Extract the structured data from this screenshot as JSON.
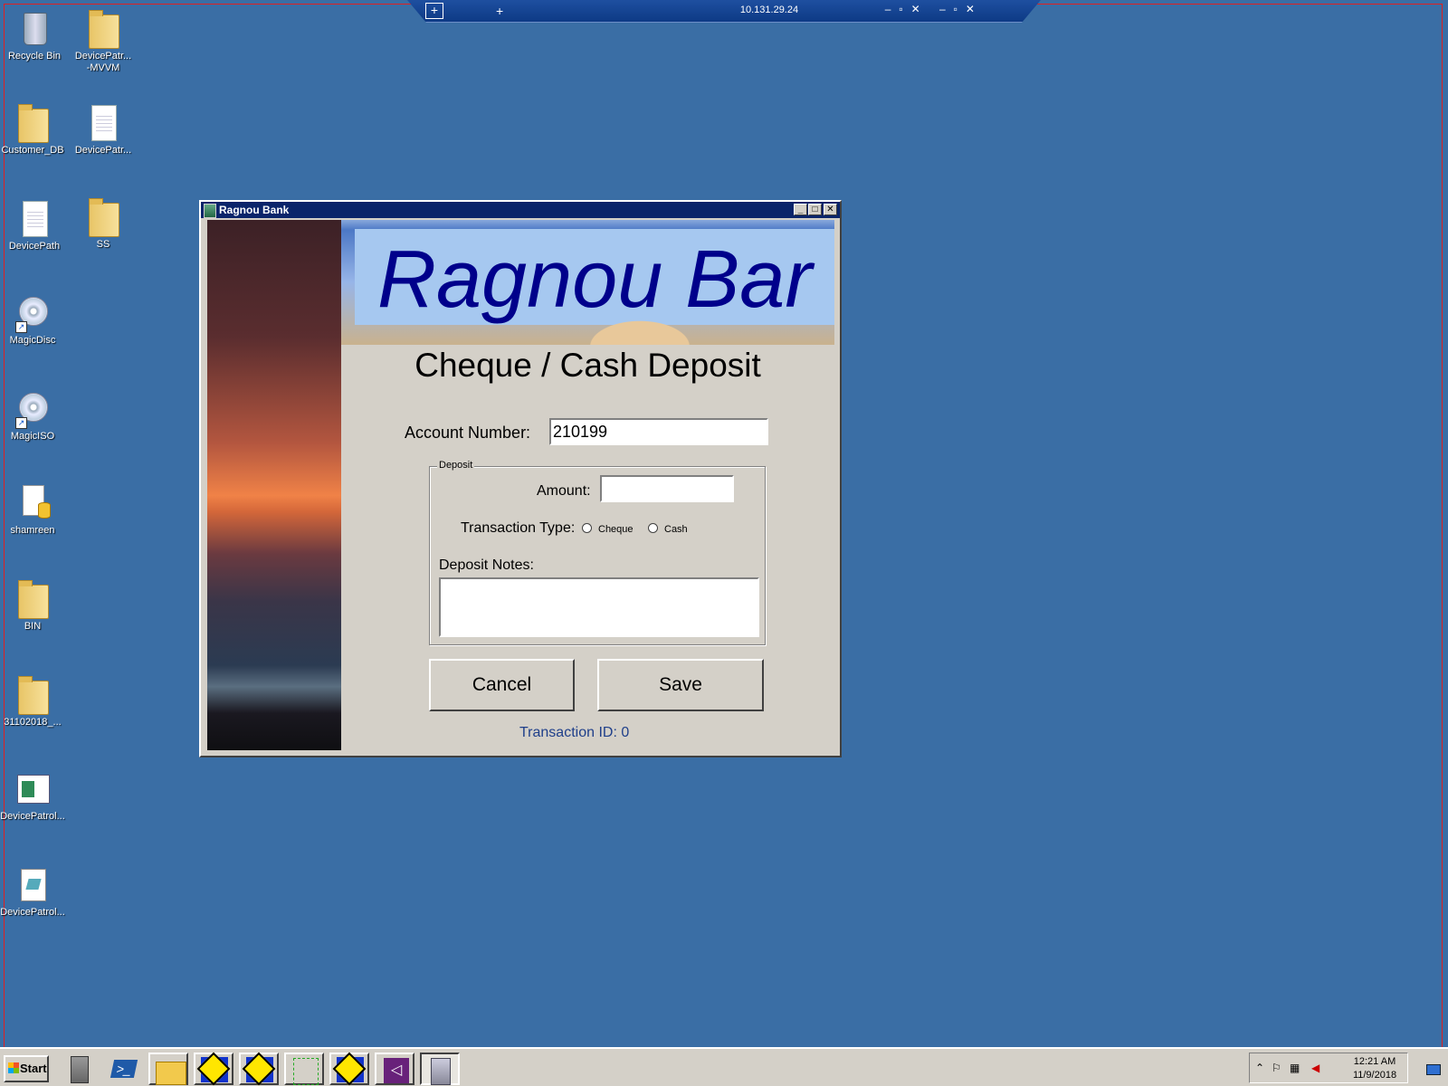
{
  "rdp_bar": {
    "host": "10.131.29.24"
  },
  "desktop": {
    "icons": [
      {
        "label": "Recycle Bin",
        "icon": "recycle-bin-icon"
      },
      {
        "label": "DevicePatr...\n-MVVM",
        "icon": "folder-icon"
      },
      {
        "label": "Customer_DB",
        "icon": "folder-icon"
      },
      {
        "label": "DevicePatr...",
        "icon": "text-document-icon"
      },
      {
        "label": "DevicePath",
        "icon": "text-document-icon"
      },
      {
        "label": "SS",
        "icon": "folder-icon"
      },
      {
        "label": "MagicDisc",
        "icon": "disc-shortcut-icon"
      },
      {
        "label": "MagicISO",
        "icon": "disc-shortcut-icon"
      },
      {
        "label": "shamreen",
        "icon": "database-file-icon"
      },
      {
        "label": "BIN",
        "icon": "folder-icon"
      },
      {
        "label": "31102018_...",
        "icon": "folder-icon"
      },
      {
        "label": "DevicePatrol...",
        "icon": "application-icon"
      },
      {
        "label": "DevicePatrol...",
        "icon": "file-icon"
      }
    ]
  },
  "window": {
    "title": "Ragnou Bank",
    "banner_text": "Ragnou Bar",
    "form_title": "Cheque / Cash Deposit",
    "account_label": "Account Number:",
    "account_value": "210199",
    "deposit_group": {
      "legend": "Deposit",
      "amount_label": "Amount:",
      "amount_value": "",
      "transaction_type_label": "Transaction Type:",
      "options": [
        "Cheque",
        "Cash"
      ],
      "notes_label": "Deposit Notes:",
      "notes_value": ""
    },
    "cancel_label": "Cancel",
    "save_label": "Save",
    "transaction_id_label": "Transaction ID:",
    "transaction_id_value": "0"
  },
  "taskbar": {
    "start_label": "Start",
    "items": [
      "server-manager-icon",
      "powershell-icon",
      "file-explorer-icon",
      "app-diamond-icon",
      "app-diamond-icon",
      "tools-icon",
      "app-diamond-icon",
      "visual-studio-icon",
      "ragnou-bank-app-icon"
    ],
    "clock_time": "12:21 AM",
    "clock_date": "11/9/2018"
  },
  "colors": {
    "desktop": "#3a6ea5",
    "title_bar": "#0a246a",
    "banner_text": "#00008b",
    "transaction_id": "#1f3f8a"
  }
}
